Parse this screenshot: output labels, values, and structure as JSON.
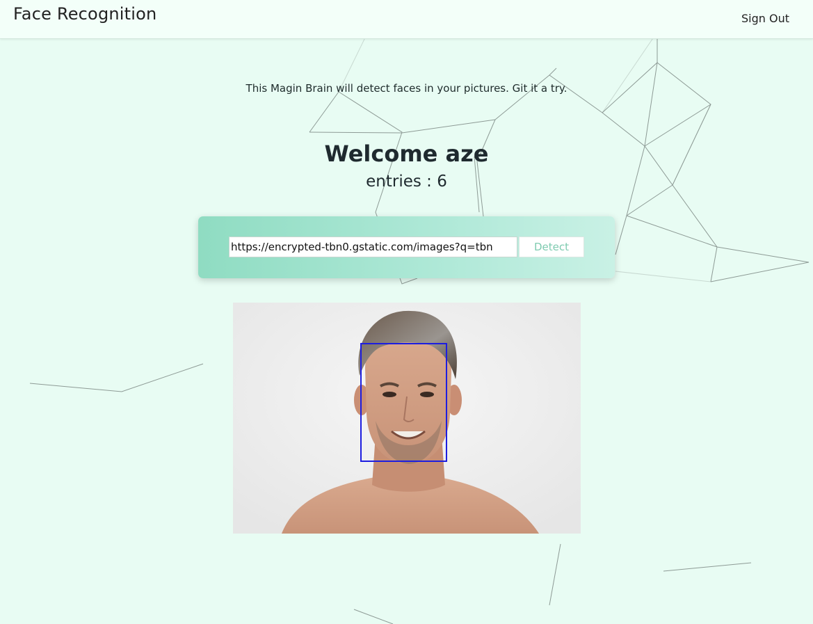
{
  "header": {
    "brand": "Face Recognition",
    "sign_out": "Sign Out"
  },
  "intro": "This Magin Brain will detect faces in your pictures. Git it a try.",
  "welcome": "Welcome aze",
  "entries": "entries : 6",
  "form": {
    "url_value": "https://encrypted-tbn0.gstatic.com/images?q=tbn",
    "detect_label": "Detect"
  },
  "image": {
    "subject": "portrait of smiling man with grey hair",
    "face_box_color": "#1d1de0"
  },
  "colors": {
    "background": "#e8fcf3",
    "header": "#f3fff9",
    "card_start": "#8fdcc2",
    "card_end": "#c9f1e5",
    "detect_text": "#7ecbb0"
  }
}
